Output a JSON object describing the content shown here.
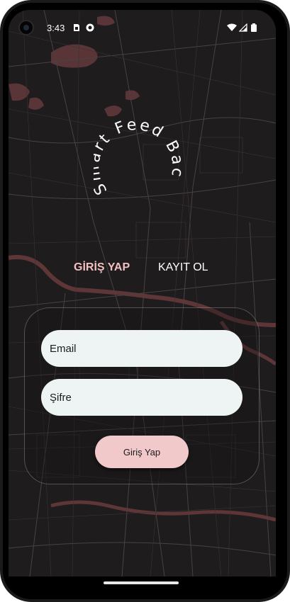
{
  "status_bar": {
    "time": "3:43"
  },
  "logo": {
    "text": "Smart Feed Back"
  },
  "tabs": [
    {
      "label": "GİRİŞ YAP",
      "active": true
    },
    {
      "label": "KAYIT OL",
      "active": false
    }
  ],
  "form": {
    "email_label": "Email",
    "password_label": "Şifre",
    "submit_label": "Giriş Yap"
  },
  "colors": {
    "accent": "#f2bfc2",
    "button": "#f2c9cb",
    "input_bg": "#eef4f4",
    "background": "#1c1a1b"
  },
  "icons": [
    "camera-icon",
    "sim-card-icon",
    "notification-icon",
    "wifi-icon",
    "signal-icon",
    "battery-icon"
  ]
}
